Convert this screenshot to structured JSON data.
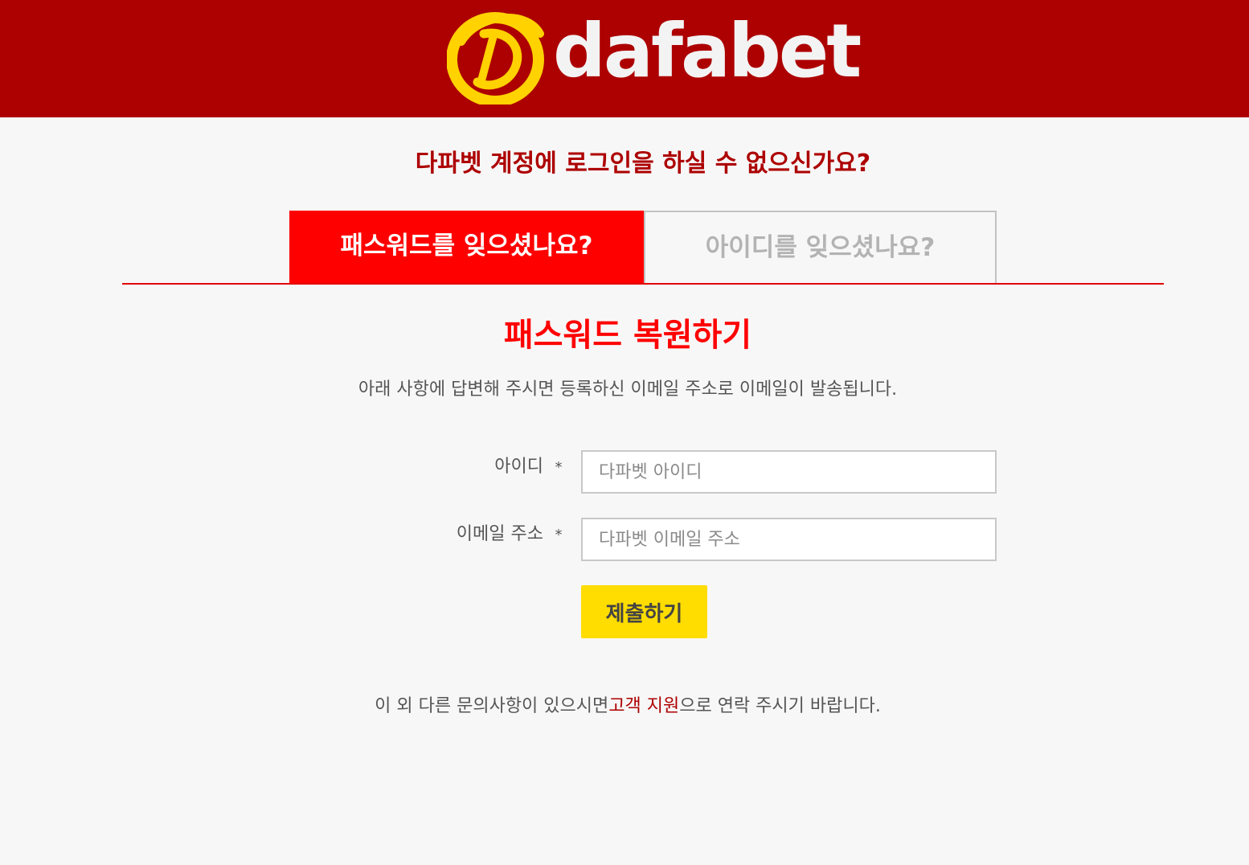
{
  "header": {
    "logo_text": "dafabet",
    "logo_icon": "dafabet-d-emblem",
    "colors": {
      "bar": "#ad0000",
      "emblem": "#ffd200",
      "logo_text": "#f3f3f3"
    }
  },
  "page": {
    "heading": "다파벳 계정에 로그인을 하실 수 없으신가요?"
  },
  "tabs": [
    {
      "label": "패스워드를 잊으셨나요?",
      "active": true
    },
    {
      "label": "아이디를 잊으셨나요?",
      "active": false
    }
  ],
  "section": {
    "title": "패스워드 복원하기",
    "description": "아래 사항에 답변해 주시면 등록하신 이메일 주소로 이메일이 발송됩니다."
  },
  "form": {
    "fields": [
      {
        "label": "아이디",
        "required_mark": "*",
        "placeholder": "다파벳 아이디",
        "value": ""
      },
      {
        "label": "이메일 주소",
        "required_mark": "*",
        "placeholder": "다파벳 이메일 주소",
        "value": ""
      }
    ],
    "submit_label": "제출하기"
  },
  "footer": {
    "text_before": "이 외 다른 문의사항이 있으시면",
    "link_text": "고객 지원",
    "text_after": "으로 연락 주시기 바랍니다."
  },
  "colors": {
    "background": "#f7f7f7",
    "accent_red": "#ff0000",
    "dark_red": "#ad0000",
    "submit_yellow": "#ffdd00"
  }
}
